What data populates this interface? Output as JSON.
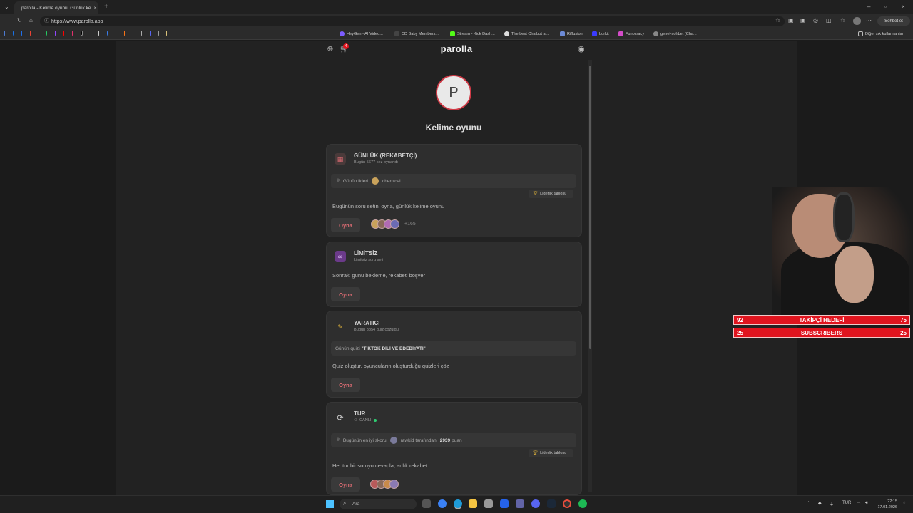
{
  "browser": {
    "tab_title": "parolla - Kelime oyunu, Günlük ke",
    "url": "https://www.parolla.app",
    "bookmarks": [
      "HeyGen - AI Video...",
      "CD Baby Members...",
      "Stream - Kick Dash...",
      "The best Chatbot a...",
      "Riffusion",
      "Lurkit",
      "Funocracy",
      "genel-sohbet (Cha..."
    ],
    "other_bookmarks": "Diğer sık kullanılanlar",
    "profile_label": "Sohbet et",
    "cart_badge": "4"
  },
  "app": {
    "logo": "parolla",
    "avatar_letter": "P",
    "page_title": "Kelime oyunu",
    "cards": [
      {
        "title": "GÜNLÜK (REKABETÇİ)",
        "subtitle": "Bugün 5677 kez oynandı",
        "bar_label": "Günün lideri",
        "bar_value": "chemical",
        "leaderboard": "Liderlik tablosu",
        "description": "Bugünün soru setini oyna, günlük kelime oyunu",
        "button": "Oyna",
        "extra_count": "+165"
      },
      {
        "title": "LİMİTSİZ",
        "subtitle": "Limitsiz soru seti",
        "description": "Sonraki günü bekleme, rekabeti boşver",
        "button": "Oyna"
      },
      {
        "title": "YARATICI",
        "subtitle": "Bugün 3854 quiz çözüldü",
        "bar_label": "Günün quizi",
        "bar_value": "\"TİKTOK DİLİ VE EDEBİYATI\"",
        "description": "Quiz oluştur, oyuncuların oluşturduğu quizleri çöz",
        "button": "Oyna"
      },
      {
        "title": "TUR",
        "subtitle": "CANLI",
        "bar_label": "Bugünün en iyi skoru",
        "bar_user": "rawkid",
        "bar_mid": "tarafından",
        "bar_score": "2939",
        "bar_unit": "puan",
        "leaderboard": "Liderlik tablosu",
        "description": "Her tur bir soruyu cevapla, anlık rekabet",
        "button": "Oyna"
      }
    ]
  },
  "overlay": {
    "follow": {
      "left": "92",
      "label": "TAKİPÇİ HEDEFİ",
      "right": "75"
    },
    "subs": {
      "left": "25",
      "label": "SUBSCRIBERS",
      "right": "25"
    }
  },
  "taskbar": {
    "search": "Ara",
    "lang": "TUR",
    "time": "22:15",
    "date": "17.01.2026"
  },
  "colors": {
    "accent": "#e06d74",
    "overlay_red": "#e0141e",
    "live_green": "#2ecc71"
  }
}
